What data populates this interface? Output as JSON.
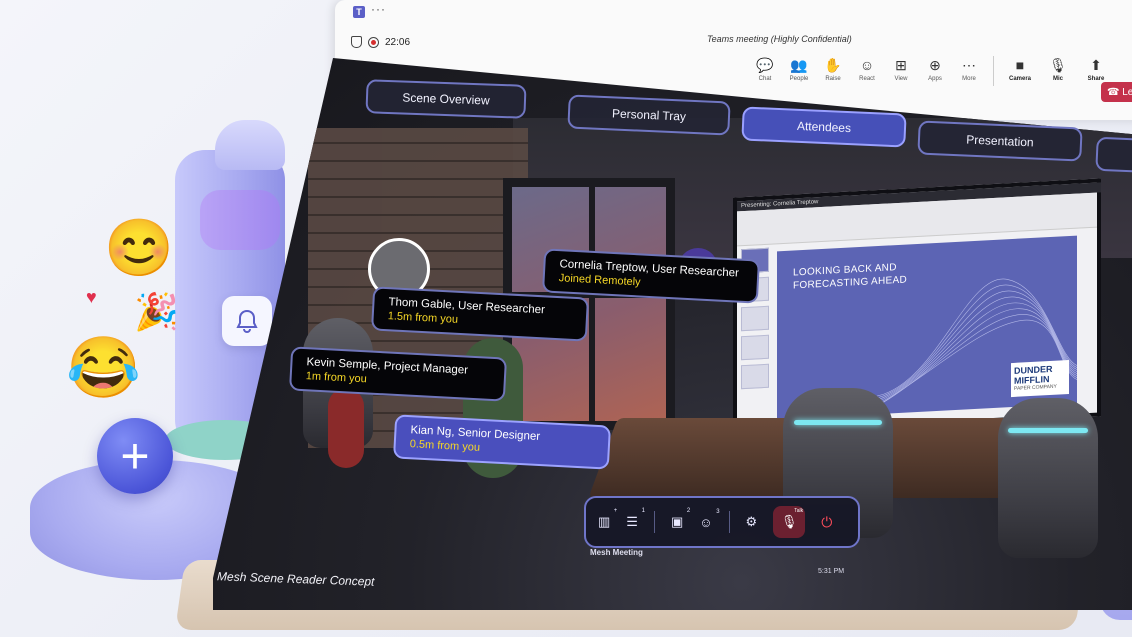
{
  "window": {
    "meeting_title": "Teams meeting (Highly Confidential)",
    "timer": "22:06",
    "toolbar": [
      {
        "label": "Chat",
        "icon": "chat-icon",
        "glyph": "💬"
      },
      {
        "label": "People",
        "icon": "people-icon",
        "glyph": "👥"
      },
      {
        "label": "Raise",
        "icon": "raise-hand-icon",
        "glyph": "✋"
      },
      {
        "label": "React",
        "icon": "react-icon",
        "glyph": "☺"
      },
      {
        "label": "View",
        "icon": "view-icon",
        "glyph": "⊞"
      },
      {
        "label": "Apps",
        "icon": "apps-icon",
        "glyph": "⊕"
      },
      {
        "label": "More",
        "icon": "more-icon",
        "glyph": "⋯"
      }
    ],
    "toolbar_media": [
      {
        "label": "Camera",
        "icon": "camera-icon",
        "glyph": "■"
      },
      {
        "label": "Mic",
        "icon": "mic-icon",
        "glyph": "🎙"
      },
      {
        "label": "Share",
        "icon": "share-icon",
        "glyph": "⬆"
      }
    ],
    "leave_label": "Le",
    "accent_color": "#5b5fc7",
    "leave_color": "#c4314b"
  },
  "scene": {
    "tabs": [
      {
        "label": "Scene Overview",
        "active": false
      },
      {
        "label": "Personal Tray",
        "active": false
      },
      {
        "label": "Attendees",
        "active": true
      },
      {
        "label": "Presentation",
        "active": false
      }
    ],
    "attendees": [
      {
        "name": "Cornelia Treptow, User Researcher",
        "status": "Joined Remotely"
      },
      {
        "name": "Thom Gable, User Researcher",
        "status": "1.5m from you"
      },
      {
        "name": "Kevin Semple, Project Manager",
        "status": "1m from you"
      },
      {
        "name": "Kian Ng, Senior Designer",
        "status": "0.5m from you"
      }
    ],
    "presenting_label": "Presenting: Cornelia Treptow",
    "slide": {
      "title": "LOOKING BACK AND FORECASTING AHEAD",
      "logo_main": "DUNDER MIFFLIN",
      "logo_sub": "PAPER COMPANY"
    },
    "hud": {
      "caption": "Mesh Meeting",
      "time": "5:31 PM",
      "icons": [
        "panel-icon",
        "list-icon",
        "tray-icon",
        "emoji-icon",
        "settings-icon",
        "mic-muted-icon",
        "leave-icon"
      ]
    },
    "concept_label": "Mesh Scene Reader Concept"
  }
}
